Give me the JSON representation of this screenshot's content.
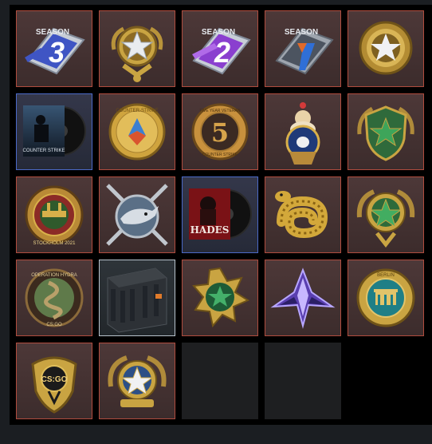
{
  "inventory": {
    "slots": [
      {
        "name": "season-3-coin",
        "rarity": "red",
        "label": "SEASON",
        "numeral": "3"
      },
      {
        "name": "gold-star-coin",
        "rarity": "red"
      },
      {
        "name": "season-2-coin",
        "rarity": "red",
        "label": "SEASON",
        "numeral": "2"
      },
      {
        "name": "season-1-coin",
        "rarity": "red",
        "label": "SEASON",
        "numeral": "1"
      },
      {
        "name": "gold-star-medal",
        "rarity": "red"
      },
      {
        "name": "music-kit-counter-strike",
        "rarity": "blue",
        "label": "COUNTER STRIKE"
      },
      {
        "name": "counter-strike-anniversary-coin",
        "rarity": "red",
        "label": "COUNTER-STRIKE"
      },
      {
        "name": "five-year-veteran-coin",
        "rarity": "red",
        "label": "FIVE YEAR VETERAN",
        "numeral": "5",
        "sublabel": "COUNTER STRIKE"
      },
      {
        "name": "cupcake-pin",
        "rarity": "red"
      },
      {
        "name": "green-star-shield-medal",
        "rarity": "red"
      },
      {
        "name": "stockholm-2021-coin",
        "rarity": "red",
        "label": "STOCKHOLM 2021"
      },
      {
        "name": "shark-crossed-swords-coin",
        "rarity": "red"
      },
      {
        "name": "music-kit-hades",
        "rarity": "blue",
        "label": "HADES"
      },
      {
        "name": "gold-snake-pin",
        "rarity": "red"
      },
      {
        "name": "green-star-wreath-medal",
        "rarity": "red"
      },
      {
        "name": "operation-hydra-coin",
        "rarity": "red",
        "label": "OPERATION HYDRA",
        "sublabel": "CS:GO"
      },
      {
        "name": "weapon-case",
        "rarity": "light"
      },
      {
        "name": "green-star-service-medal",
        "rarity": "red"
      },
      {
        "name": "purple-crystal-pin",
        "rarity": "red"
      },
      {
        "name": "berlin-2019-coin",
        "rarity": "red",
        "label": "BERLIN"
      },
      {
        "name": "csgo-badge-coin",
        "rarity": "red",
        "label": "CS:GO"
      },
      {
        "name": "blue-star-wreath-medal",
        "rarity": "red"
      },
      {
        "name": "empty-slot",
        "rarity": "empty"
      },
      {
        "name": "empty-slot",
        "rarity": "empty"
      }
    ]
  }
}
